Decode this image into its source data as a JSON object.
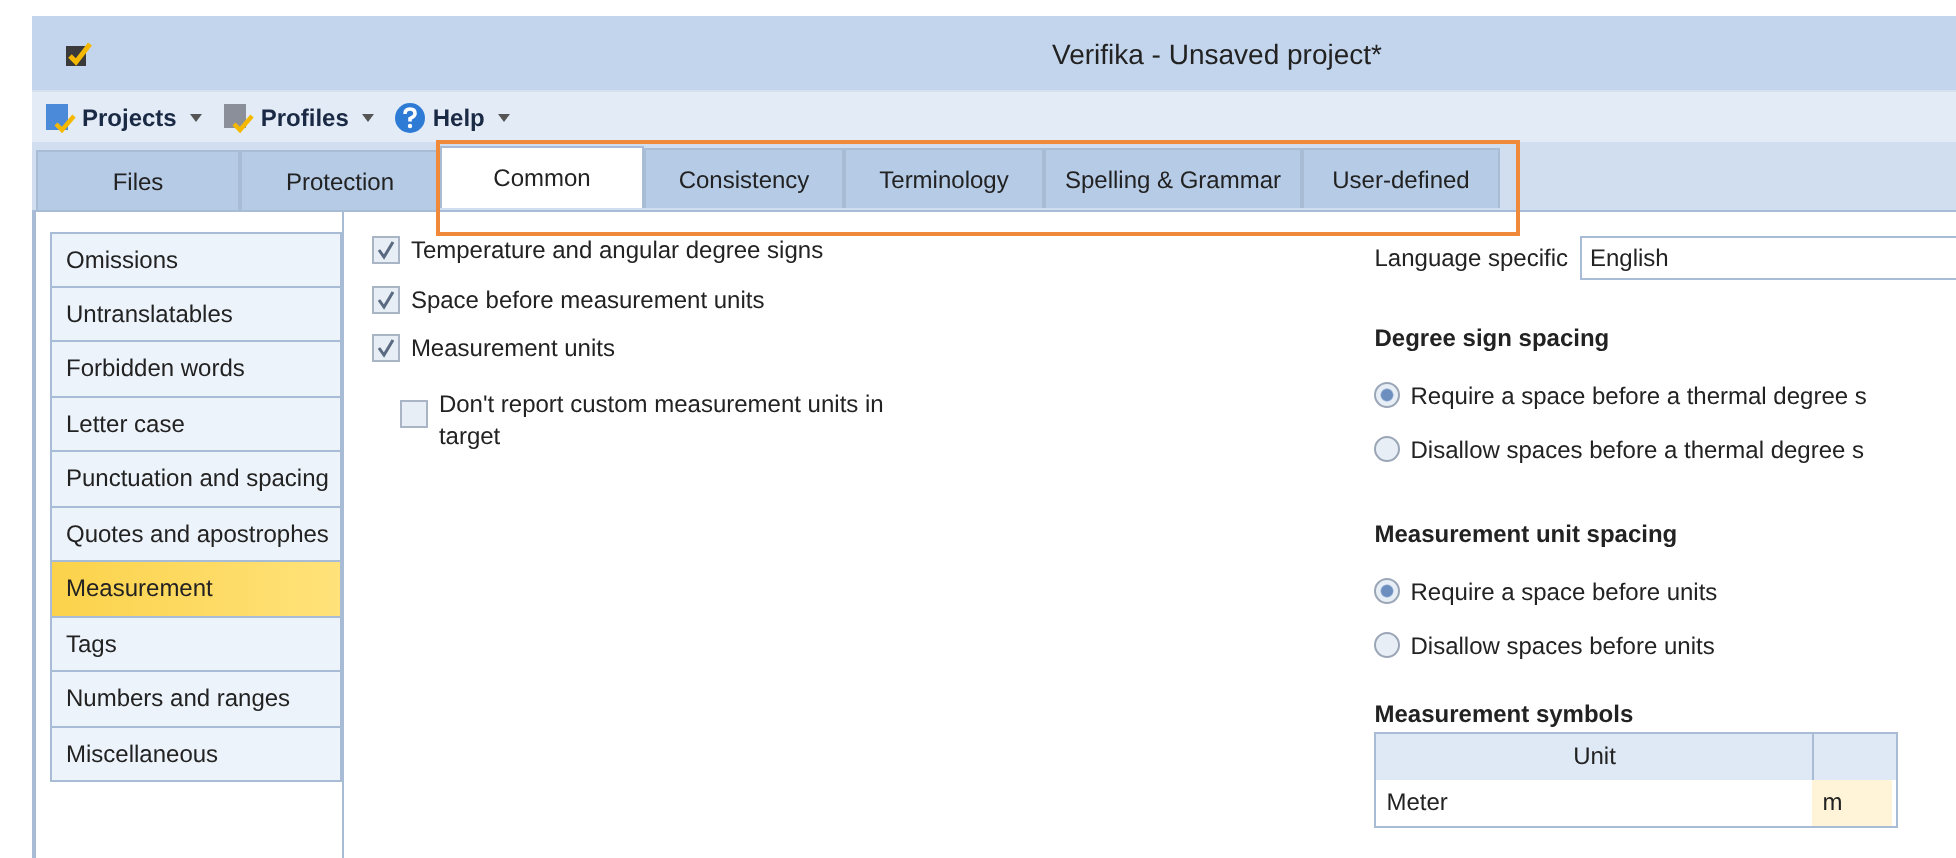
{
  "window": {
    "title": "Verifika - Unsaved project*"
  },
  "menu": [
    {
      "label": "Projects",
      "kind": "project"
    },
    {
      "label": "Profiles",
      "kind": "profile"
    },
    {
      "label": "Help",
      "kind": "help"
    }
  ],
  "tabs": [
    {
      "label": "Files",
      "selected": false,
      "highlighted": false
    },
    {
      "label": "Protection",
      "selected": false,
      "highlighted": false
    },
    {
      "label": "Common",
      "selected": true,
      "highlighted": true
    },
    {
      "label": "Consistency",
      "selected": false,
      "highlighted": true
    },
    {
      "label": "Terminology",
      "selected": false,
      "highlighted": true
    },
    {
      "label": "Spelling & Grammar",
      "selected": false,
      "highlighted": true
    },
    {
      "label": "User-defined",
      "selected": false,
      "highlighted": true
    }
  ],
  "sidebar": {
    "items": [
      {
        "label": "Omissions",
        "selected": false
      },
      {
        "label": "Untranslatables",
        "selected": false
      },
      {
        "label": "Forbidden words",
        "selected": false
      },
      {
        "label": "Letter case",
        "selected": false
      },
      {
        "label": "Punctuation and spacing",
        "selected": false
      },
      {
        "label": "Quotes and apostrophes",
        "selected": false
      },
      {
        "label": "Measurement",
        "selected": true
      },
      {
        "label": "Tags",
        "selected": false
      },
      {
        "label": "Numbers and ranges",
        "selected": false
      },
      {
        "label": "Miscellaneous",
        "selected": false
      }
    ]
  },
  "options": [
    {
      "label": "Temperature and angular degree signs",
      "checked": true,
      "nested": false
    },
    {
      "label": "Space before measurement units",
      "checked": true,
      "nested": false
    },
    {
      "label": "Measurement units",
      "checked": true,
      "nested": false
    },
    {
      "label": "Don't report custom measurement units in target",
      "checked": false,
      "nested": true
    }
  ],
  "language": {
    "label": "Language specific",
    "value": "English"
  },
  "groups": [
    {
      "title": "Degree sign spacing",
      "options": [
        {
          "label": "Require a space before a thermal degree s",
          "selected": true
        },
        {
          "label": "Disallow spaces before a thermal degree s",
          "selected": false
        }
      ]
    },
    {
      "title": "Measurement unit spacing",
      "options": [
        {
          "label": "Require a space before units",
          "selected": true
        },
        {
          "label": "Disallow spaces before units",
          "selected": false
        }
      ]
    }
  ],
  "symbols": {
    "title": "Measurement symbols",
    "columns": [
      "Unit"
    ],
    "rows": [
      [
        "Meter",
        "m"
      ]
    ]
  }
}
